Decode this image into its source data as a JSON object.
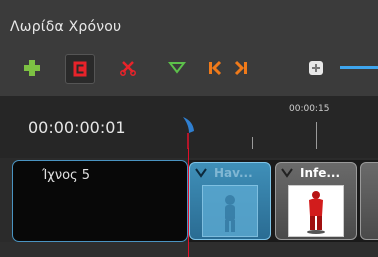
{
  "window": {
    "title": "Λωρίδα Χρόνου"
  },
  "toolbar": {
    "buttons": [
      {
        "name": "add-track",
        "icon": "plus-icon",
        "color": "#7dc143"
      },
      {
        "name": "snap",
        "icon": "magnet-icon",
        "color": "#e8232a",
        "active": true
      },
      {
        "name": "razor",
        "icon": "scissors-icon",
        "color": "#e8232a"
      },
      {
        "name": "add-marker",
        "icon": "triangle-down-icon",
        "color": "#5cc04a"
      },
      {
        "name": "previous-marker",
        "icon": "previous-marker-icon",
        "color": "#f07a1a"
      },
      {
        "name": "next-marker",
        "icon": "next-marker-icon",
        "color": "#f07a1a"
      },
      {
        "name": "zoom",
        "icon": "zoom-icon",
        "color": "#dddddd"
      }
    ],
    "zoom_track_color": "#3ea5ee"
  },
  "timeline": {
    "current_time": "00:00:00:01",
    "ruler_labels": [
      "00:00:15"
    ],
    "playhead_color": "#e0102a"
  },
  "tracks": [
    {
      "name": "Ίχνος 5",
      "clips": [
        {
          "title": "Hav...",
          "selected": true,
          "thumbnail": "figure-icon"
        },
        {
          "title": "Infe...",
          "selected": false,
          "thumbnail": "red-figure-icon"
        },
        {
          "title": "",
          "selected": false
        }
      ]
    }
  ]
}
